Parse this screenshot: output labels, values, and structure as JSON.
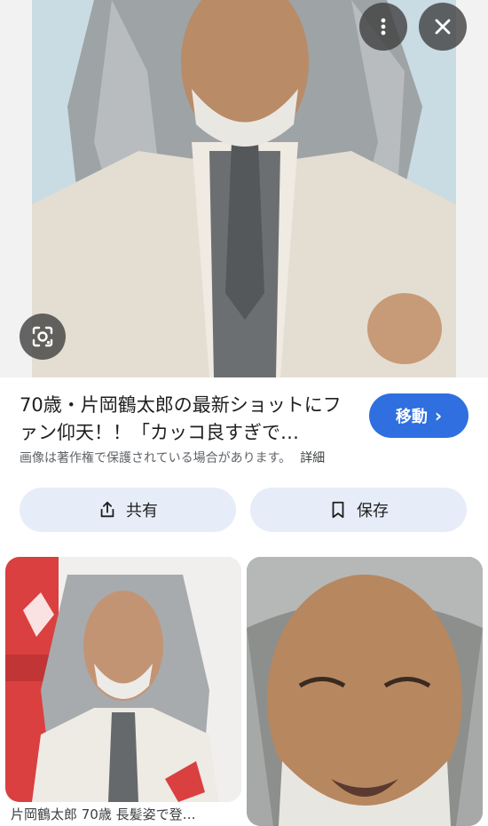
{
  "image_viewer": {
    "more_icon": "more-vert-icon",
    "close_icon": "close-icon",
    "lens_icon": "lens-icon"
  },
  "result": {
    "title": "70歳・片岡鶴太郎の最新ショットにファン仰天！！「カッコ良すぎで…",
    "visit_label": "移動",
    "visit_color": "#2f6fe0",
    "copyright_notice": "画像は著作権で保護されている場合があります。",
    "details_link": "詳細"
  },
  "actions": {
    "share_label": "共有",
    "save_label": "保存",
    "share_icon": "share-icon",
    "save_icon": "bookmark-icon"
  },
  "related": {
    "items": [
      {
        "caption": "片岡鶴太郎 70歳 長髪姿で登…"
      }
    ]
  }
}
